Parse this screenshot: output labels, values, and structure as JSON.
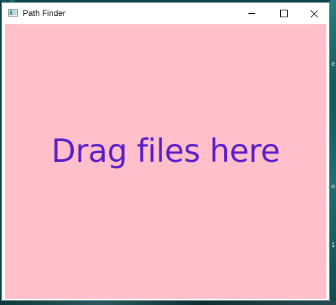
{
  "window": {
    "title": "Path Finder",
    "controls": {
      "minimize": "minimize",
      "maximize": "maximize",
      "close": "close"
    }
  },
  "drop_zone": {
    "message": "Drag files here",
    "background_color": "#ffc0cb",
    "text_color": "#5a1ec8"
  },
  "desktop": {
    "edge_glyphs": [
      "e",
      "o",
      "1"
    ]
  }
}
